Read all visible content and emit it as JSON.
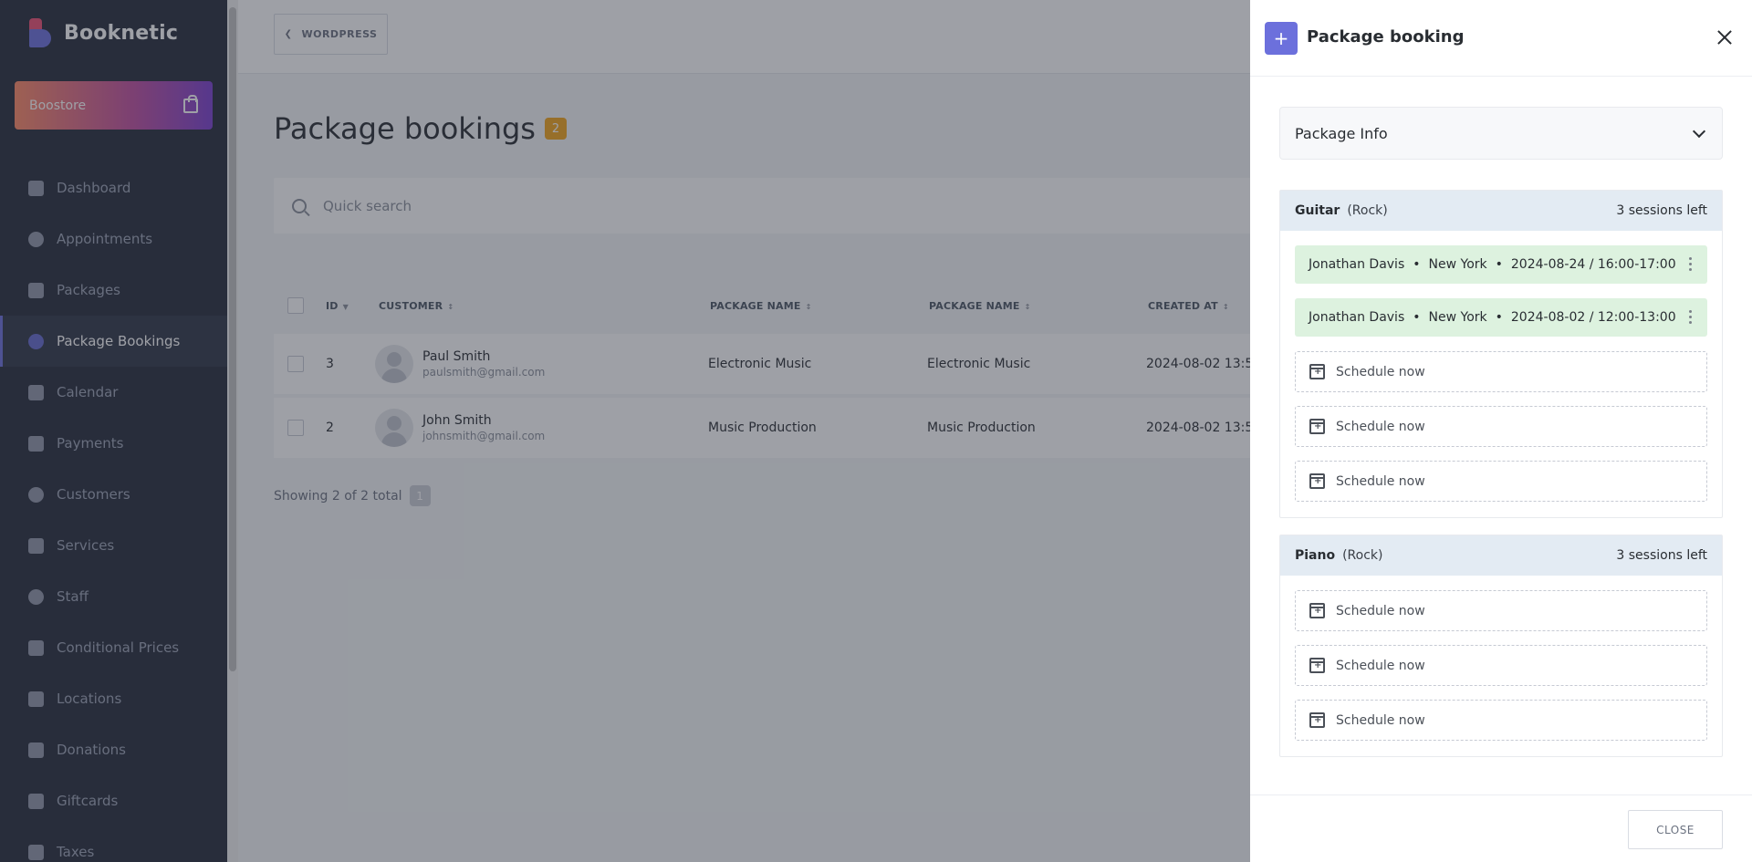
{
  "app": {
    "name": "Booknetic"
  },
  "sidebar": {
    "boostore_label": "Boostore",
    "items": [
      {
        "label": "Dashboard",
        "icon": "dashboard-icon"
      },
      {
        "label": "Appointments",
        "icon": "clock-icon"
      },
      {
        "label": "Packages",
        "icon": "list-icon"
      },
      {
        "label": "Package Bookings",
        "icon": "clock-icon",
        "active": true
      },
      {
        "label": "Calendar",
        "icon": "calendar-icon"
      },
      {
        "label": "Payments",
        "icon": "credit-card-icon"
      },
      {
        "label": "Customers",
        "icon": "users-icon"
      },
      {
        "label": "Services",
        "icon": "list-icon"
      },
      {
        "label": "Staff",
        "icon": "user-icon"
      },
      {
        "label": "Conditional Prices",
        "icon": "cursor-icon"
      },
      {
        "label": "Locations",
        "icon": "location-arrow-icon"
      },
      {
        "label": "Donations",
        "icon": "donation-icon"
      },
      {
        "label": "Giftcards",
        "icon": "gift-icon"
      },
      {
        "label": "Taxes",
        "icon": "percent-icon"
      }
    ]
  },
  "topbar": {
    "wordpress_label": "WORDPRESS"
  },
  "page": {
    "title": "Package bookings",
    "count": "2",
    "search_placeholder": "Quick search"
  },
  "table": {
    "columns": [
      "ID",
      "CUSTOMER",
      "PACKAGE NAME",
      "PACKAGE NAME",
      "CREATED AT"
    ],
    "rows": [
      {
        "id": "3",
        "customer_name": "Paul Smith",
        "customer_email": "paulsmith@gmail.com",
        "package1": "Electronic Music",
        "package2": "Electronic Music",
        "created_at": "2024-08-02 13:5"
      },
      {
        "id": "2",
        "customer_name": "John Smith",
        "customer_email": "johnsmith@gmail.com",
        "package1": "Music Production",
        "package2": "Music Production",
        "created_at": "2024-08-02 13:5"
      }
    ]
  },
  "pagination": {
    "showing_text": "Showing 2 of 2 total",
    "current_page": "1"
  },
  "panel": {
    "title": "Package booking",
    "package_info_label": "Package Info",
    "close_label": "CLOSE",
    "services": [
      {
        "name": "Guitar",
        "category": "(Rock)",
        "sessions_left": "3 sessions left",
        "booked": [
          {
            "staff": "Jonathan Davis",
            "location": "New York",
            "datetime": "2024-08-24 / 16:00-17:00"
          },
          {
            "staff": "Jonathan Davis",
            "location": "New York",
            "datetime": "2024-08-02 / 12:00-13:00"
          }
        ],
        "schedule_labels": [
          "Schedule now",
          "Schedule now",
          "Schedule now"
        ]
      },
      {
        "name": "Piano",
        "category": "(Rock)",
        "sessions_left": "3 sessions left",
        "booked": [],
        "schedule_labels": [
          "Schedule now",
          "Schedule now",
          "Schedule now"
        ]
      }
    ],
    "separator": "•"
  },
  "colors": {
    "accent": "#6c70dc",
    "sidebar_bg": "#262c3a",
    "badge": "#f2a51a",
    "booked_bg": "#ddf2df",
    "service_head_bg": "#e3ebf3"
  }
}
